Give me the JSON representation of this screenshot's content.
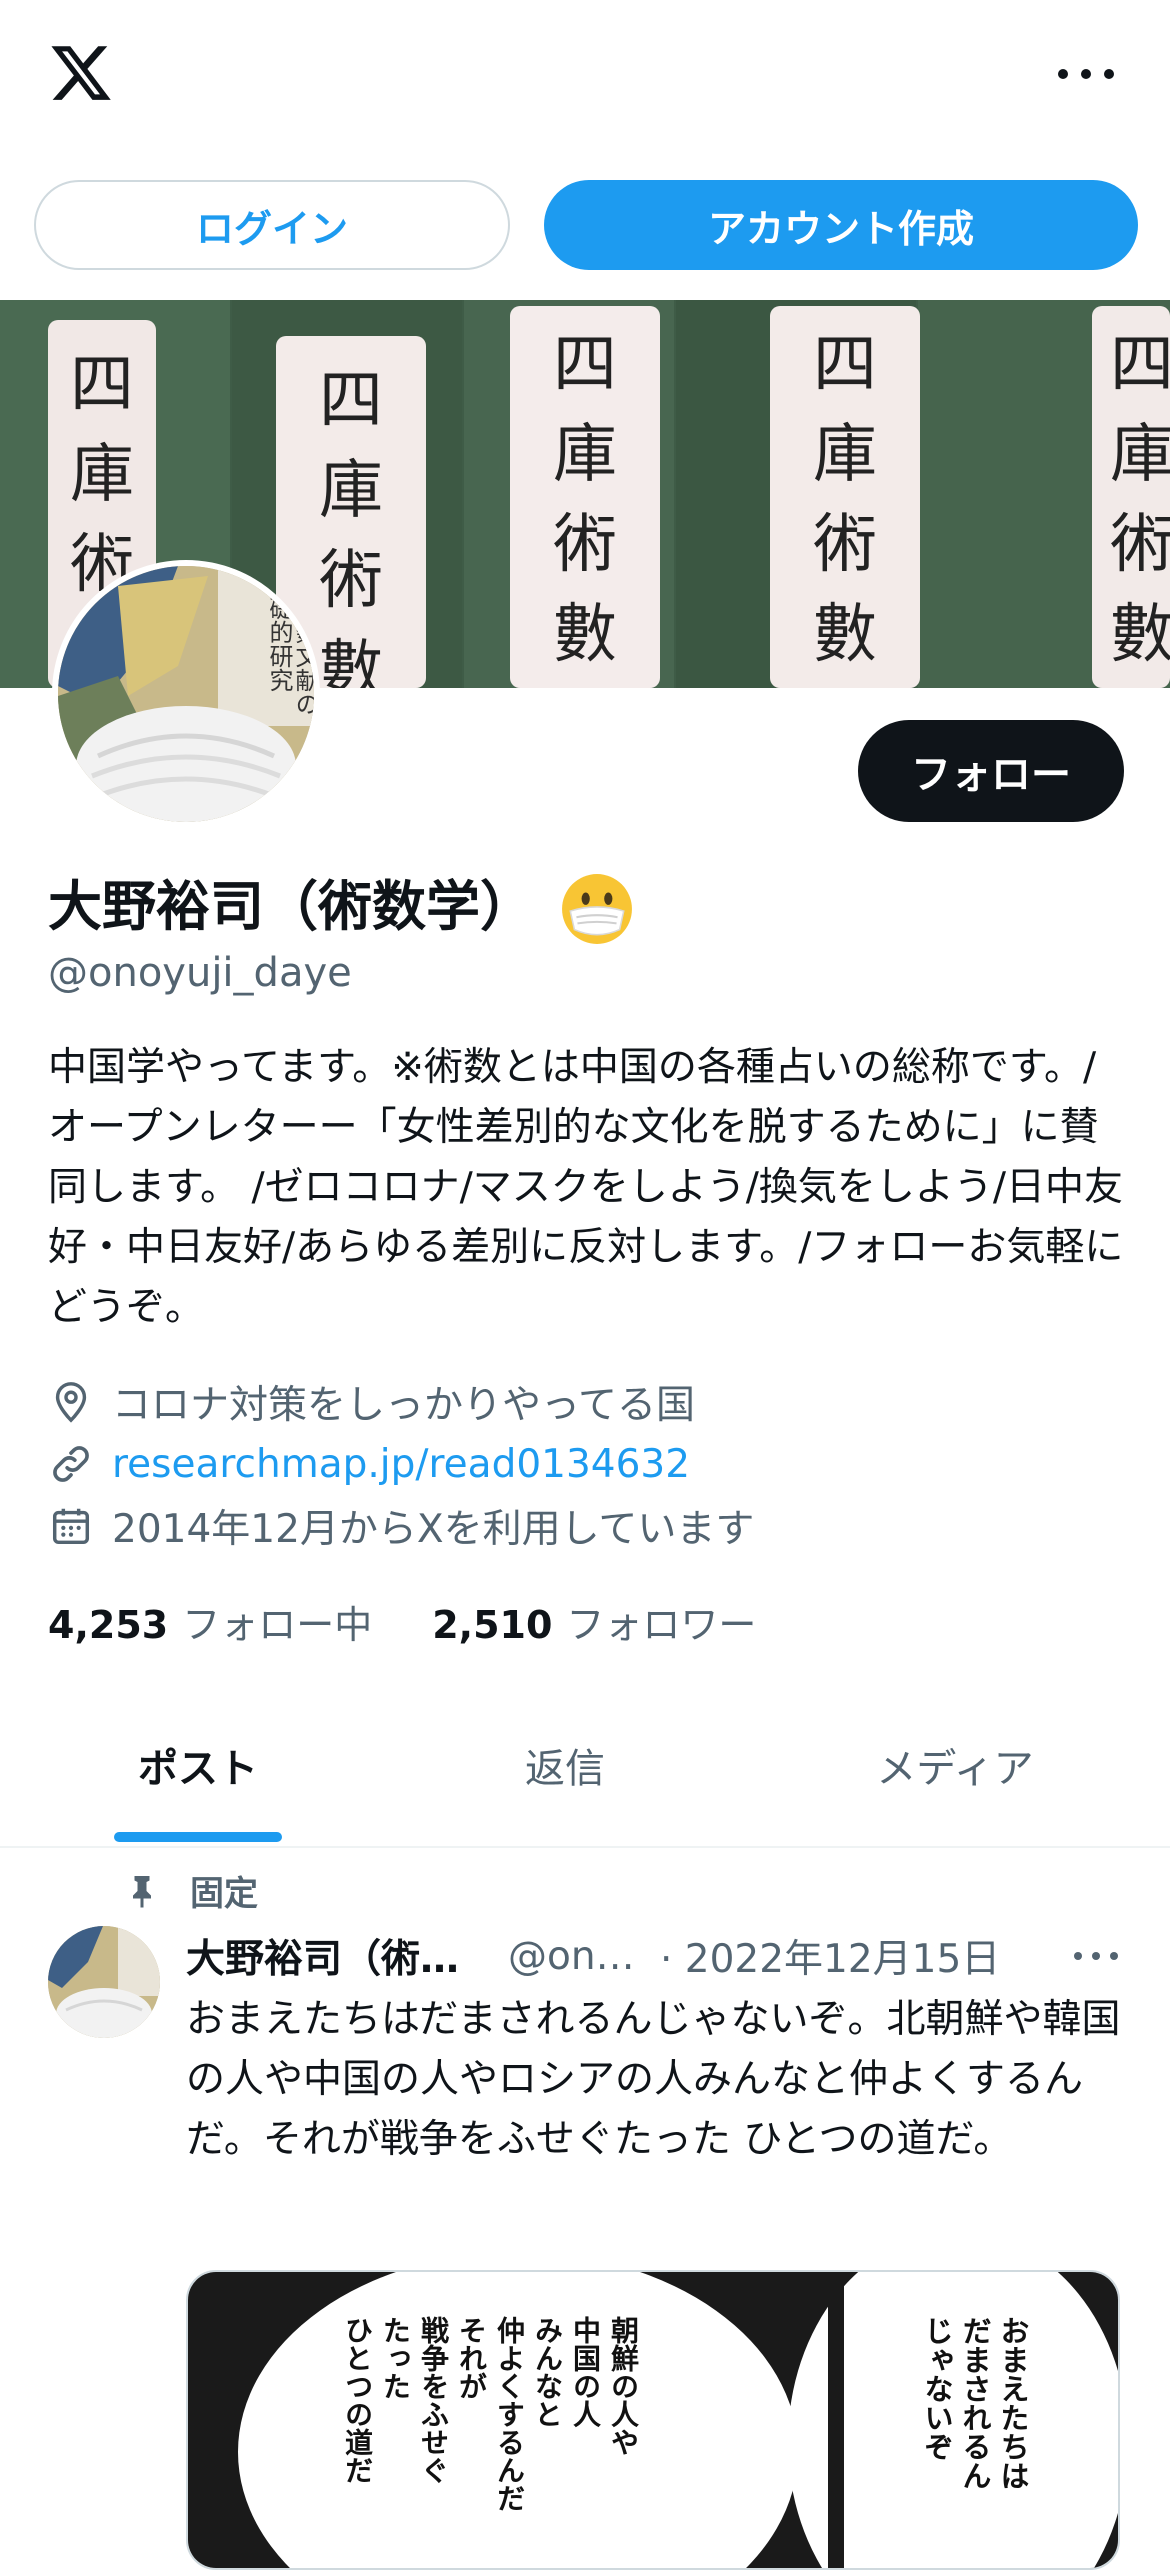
{
  "colors": {
    "accent": "#1d9bf0",
    "text": "#0f1419",
    "secondary": "#536471",
    "border": "#cfd9de"
  },
  "top_bar": {
    "logo_icon": "x-logo-icon",
    "more_icon": "more-horizontal-icon"
  },
  "auth": {
    "login_label": "ログイン",
    "signup_label": "アカウント作成"
  },
  "banner": {
    "spine_text": [
      "四庫術數類叢書",
      "四庫術數類叢書",
      "四庫術數類叢書",
      "四庫術數類叢書",
      "四庫術數類叢書"
    ]
  },
  "avatar": {
    "text": "漢術数文献の基礎的研究"
  },
  "profile": {
    "follow_label": "フォロー",
    "display_name": "大野裕司（術数学）",
    "name_emoji": "mask-face-emoji",
    "handle": "@onoyuji_daye",
    "bio": "中国学やってます。※術数とは中国の各種占いの総称です。/オープンレターー「女性差別的な文化を脱するために」に賛同します。 /ゼロコロナ/マスクをしよう/換気をしよう/日中友好・中日友好/あらゆる差別に反対します。/フォローお気軽にどうぞ。",
    "location": "コロナ対策をしっかりやってる国",
    "link": "researchmap.jp/read0134632",
    "joined": "2014年12月からXを利用しています",
    "following_count": "4,253",
    "following_label": "フォロー中",
    "followers_count": "2,510",
    "followers_label": "フォロワー"
  },
  "tabs": [
    {
      "label": "ポスト",
      "active": true
    },
    {
      "label": "返信",
      "active": false
    },
    {
      "label": "メディア",
      "active": false
    }
  ],
  "pinned_post": {
    "pinned_label": "固定",
    "author_name": "大野裕司（術数学）",
    "author_handle": "@onoyuji_daye",
    "date": "· 2022年12月15日",
    "text": "おまえたちはだまされるんじゃないぞ。北朝鮮や韓国の人や中国の人やロシアの人みんなと仲よくするんだ。それが戦争をふせぐたった ひとつの道だ。",
    "image_columns": [
      "おまえたちは",
      "だまされるん",
      "じゃないぞ",
      "朝鮮の人や",
      "中国の人",
      "みんなと",
      "仲よくするんだ",
      "それが",
      "戦争をふせぐ",
      "たった",
      "ひとつの道だ"
    ]
  }
}
